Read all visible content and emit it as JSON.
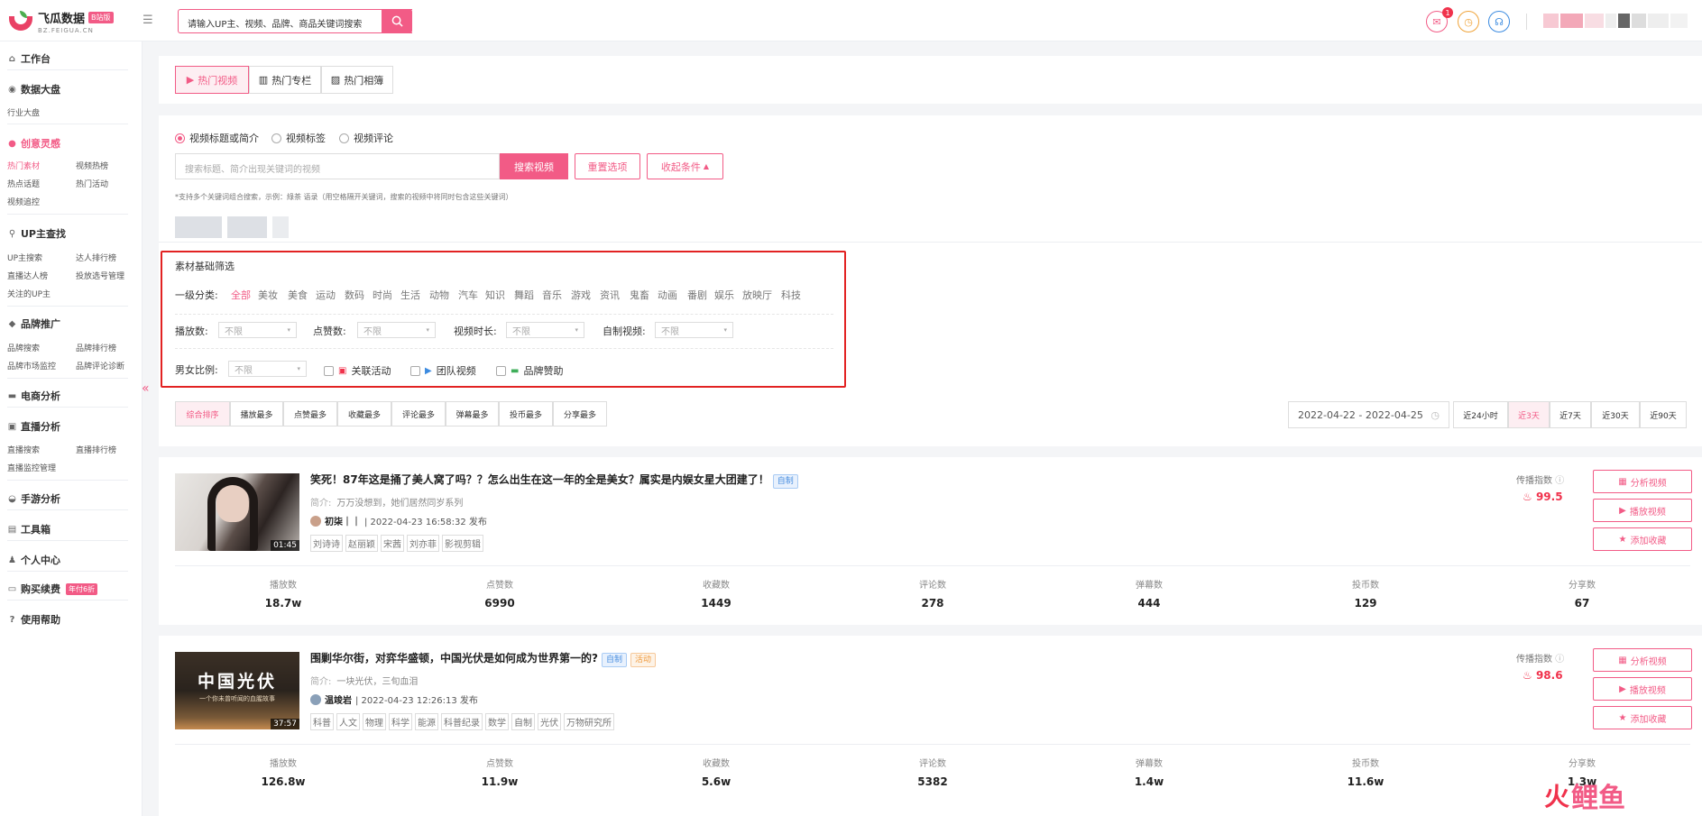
{
  "brand": {
    "name": "飞瓜数据",
    "version": "B站版",
    "domain": "BZ.FEIGUA.CN"
  },
  "header": {
    "search_value": "请输入UP主、视频、品牌、商品关键词搜索",
    "notify_count": "1"
  },
  "sidebar": {
    "workbench": "工作台",
    "dashboard": "数据大盘",
    "dashboard_items": [
      "行业大盘"
    ],
    "creative": "创意灵感",
    "creative_items": [
      "热门素材",
      "视频热榜",
      "热点话题",
      "热门活动",
      "视频追控"
    ],
    "up": "UP主查找",
    "up_items": [
      "UP主搜索",
      "达人排行榜",
      "直播达人榜",
      "投放选号管理",
      "关注的UP主"
    ],
    "brand": "品牌推广",
    "brand_items": [
      "品牌搜索",
      "品牌排行榜",
      "品牌市场监控",
      "品牌评论诊断"
    ],
    "ecom": "电商分析",
    "live": "直播分析",
    "live_items": [
      "直播搜索",
      "直播排行榜",
      "直播监控管理"
    ],
    "game": "手游分析",
    "tools": "工具箱",
    "personal": "个人中心",
    "buy": "购买续费",
    "buy_tag": "年付6折",
    "help": "使用帮助"
  },
  "tabs": [
    "热门视频",
    "热门专栏",
    "热门相簿"
  ],
  "search_panel": {
    "radios": [
      "视频标题或简介",
      "视频标签",
      "视频评论"
    ],
    "placeholder": "搜索标题、简介出现关键词的视频",
    "search_btn": "搜索视频",
    "reset_btn": "重置选项",
    "collapse_btn": "收起条件",
    "hint": "*支持多个关键词组合搜索，示例：綠茶 语录（用空格隔开关键词，搜索的视频中将同时包含这些关键词）"
  },
  "filter": {
    "title": "素材基础筛选",
    "cat_label": "一级分类:",
    "categories": [
      "全部",
      "美妆",
      "美食",
      "运动",
      "数码",
      "时尚",
      "生活",
      "动物",
      "汽车",
      "知识",
      "舞蹈",
      "音乐",
      "游戏",
      "资讯",
      "鬼畜",
      "动画",
      "番剧",
      "娱乐",
      "放映厅",
      "科技"
    ],
    "play_label": "播放数:",
    "like_label": "点赞数:",
    "dur_label": "视频时长:",
    "self_label": "自制视频:",
    "gender_label": "男女比例:",
    "unlimited": "不限",
    "checks": [
      "关联活动",
      "团队视频",
      "品牌赞助"
    ]
  },
  "sort": {
    "options": [
      "综合排序",
      "播放最多",
      "点赞最多",
      "收藏最多",
      "评论最多",
      "弹幕最多",
      "投币最多",
      "分享最多"
    ]
  },
  "date": {
    "range": "2022-04-22 - 2022-04-25",
    "options": [
      "近24小时",
      "近3天",
      "近7天",
      "近30天",
      "近90天"
    ]
  },
  "labels": {
    "heat": "传播指数",
    "intro": "简介:",
    "analyze": "分析视频",
    "play": "播放视频",
    "collect": "添加收藏",
    "stats": [
      "播放数",
      "点赞数",
      "收藏数",
      "评论数",
      "弹幕数",
      "投币数",
      "分享数"
    ]
  },
  "videos": [
    {
      "title": "笑死！87年这是捅了美人窝了吗？？怎么出生在这一年的全是美女？属实是内娱女星大团建了！",
      "badges": [
        "自制"
      ],
      "desc": "万万没想到，她们居然同岁系列",
      "author": "初柒｜｜",
      "time": "| 2022-04-23 16:58:32 发布",
      "tags": [
        "刘诗诗",
        "赵丽颖",
        "宋茜",
        "刘亦菲",
        "影视剪辑"
      ],
      "duration": "01:45",
      "heat": "99.5",
      "stats": [
        "18.7w",
        "6990",
        "1449",
        "278",
        "444",
        "129",
        "67"
      ]
    },
    {
      "title": "围剿华尔街，对弈华盛顿，中国光伏是如何成为世界第一的?",
      "badges": [
        "自制",
        "活动"
      ],
      "desc": "一块光伏，三旬血泪",
      "author": "温竣岩",
      "time": "| 2022-04-23 12:26:13 发布",
      "tags": [
        "科普",
        "人文",
        "物理",
        "科学",
        "能源",
        "科普纪录",
        "数学",
        "自制",
        "光伏",
        "万物研究所"
      ],
      "duration": "37:57",
      "heat": "98.6",
      "thumb_title": "中国光伏",
      "thumb_sub": "一个你未曾听闻的血腥故事",
      "stats": [
        "126.8w",
        "11.9w",
        "5.6w",
        "5382",
        "1.4w",
        "11.6w",
        "1.3w"
      ]
    }
  ],
  "watermark": "鲤鱼"
}
